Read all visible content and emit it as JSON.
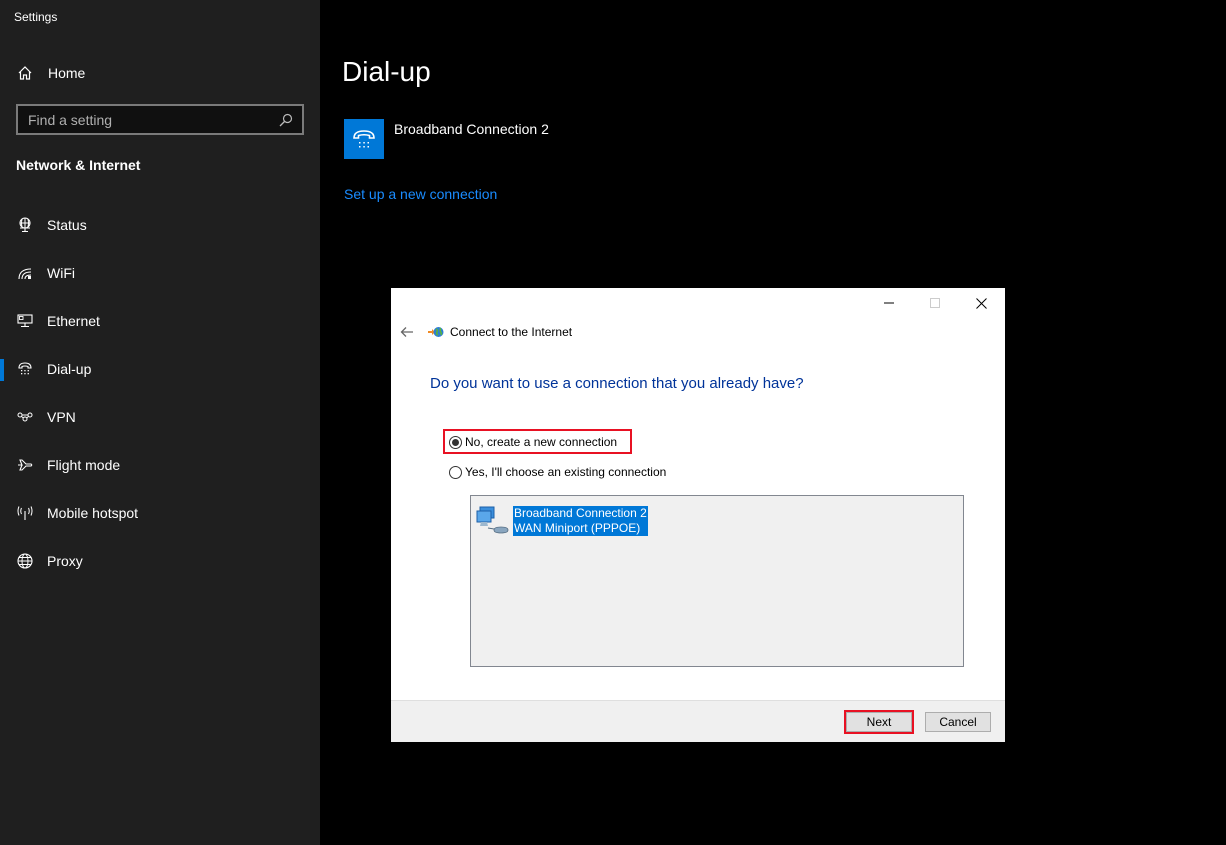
{
  "window": {
    "title": "Settings"
  },
  "sidebar": {
    "home_label": "Home",
    "search_placeholder": "Find a setting",
    "section_title": "Network & Internet",
    "items": [
      {
        "label": "Status",
        "icon": "status-globe-icon",
        "active": false
      },
      {
        "label": "WiFi",
        "icon": "wifi-icon",
        "active": false
      },
      {
        "label": "Ethernet",
        "icon": "ethernet-icon",
        "active": false
      },
      {
        "label": "Dial-up",
        "icon": "dialup-phone-icon",
        "active": true
      },
      {
        "label": "VPN",
        "icon": "vpn-icon",
        "active": false
      },
      {
        "label": "Flight mode",
        "icon": "airplane-icon",
        "active": false
      },
      {
        "label": "Mobile hotspot",
        "icon": "hotspot-icon",
        "active": false
      },
      {
        "label": "Proxy",
        "icon": "globe-icon",
        "active": false
      }
    ],
    "accent_color": "#0078d7"
  },
  "main": {
    "title": "Dial-up",
    "connection_name": "Broadband Connection 2",
    "setup_link": "Set up a new connection"
  },
  "dialog": {
    "title": "Connect to the Internet",
    "question": "Do you want to use a connection that you already have?",
    "options": [
      {
        "label": "No, create a new connection",
        "selected": true,
        "highlighted": true
      },
      {
        "label": "Yes, I'll choose an existing connection",
        "selected": false,
        "highlighted": false
      }
    ],
    "list": [
      {
        "line1": "Broadband Connection 2",
        "line2": "WAN Miniport (PPPOE)",
        "selected": true
      }
    ],
    "buttons": {
      "next": "Next",
      "cancel": "Cancel"
    },
    "highlight_color": "#e81123"
  }
}
